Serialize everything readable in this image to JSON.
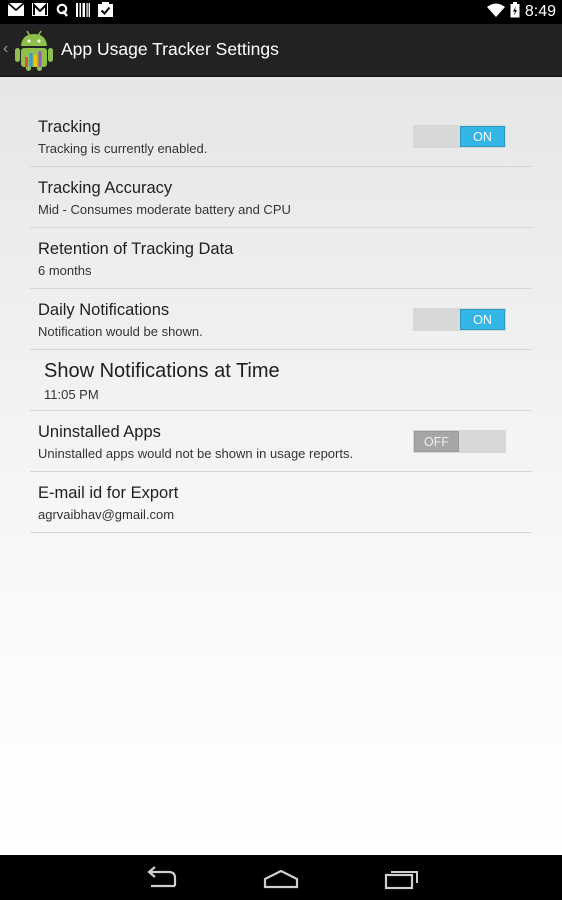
{
  "status_bar": {
    "time": "8:49",
    "left_icons": [
      "mail-icon",
      "gmail-icon",
      "q-icon",
      "barcode-icon",
      "clipboard-check-icon"
    ],
    "right_icons": [
      "wifi-icon",
      "battery-icon"
    ]
  },
  "action_bar": {
    "title": "App Usage Tracker Settings",
    "icon": "android-app-icon"
  },
  "preferences": [
    {
      "title": "Tracking",
      "summary": "Tracking is currently enabled.",
      "toggle": "ON"
    },
    {
      "title": "Tracking Accuracy",
      "summary": "Mid - Consumes moderate battery and CPU"
    },
    {
      "title": "Retention of Tracking Data",
      "summary": "6 months"
    },
    {
      "title": "Daily Notifications",
      "summary": "Notification would be shown.",
      "toggle": "ON"
    },
    {
      "title": "Show Notifications at Time",
      "summary": "11:05 PM"
    },
    {
      "title": "Uninstalled Apps",
      "summary": "Uninstalled apps would not be shown in usage reports.",
      "toggle": "OFF"
    },
    {
      "title": "E-mail id for Export",
      "summary": "agrvaibhav@gmail.com"
    }
  ],
  "nav_bar": {
    "buttons": [
      "back-icon",
      "home-icon",
      "recent-apps-icon"
    ]
  },
  "colors": {
    "accent": "#33b5e5",
    "action_bar": "#222222",
    "toggle_off": "#a6a6a6"
  }
}
